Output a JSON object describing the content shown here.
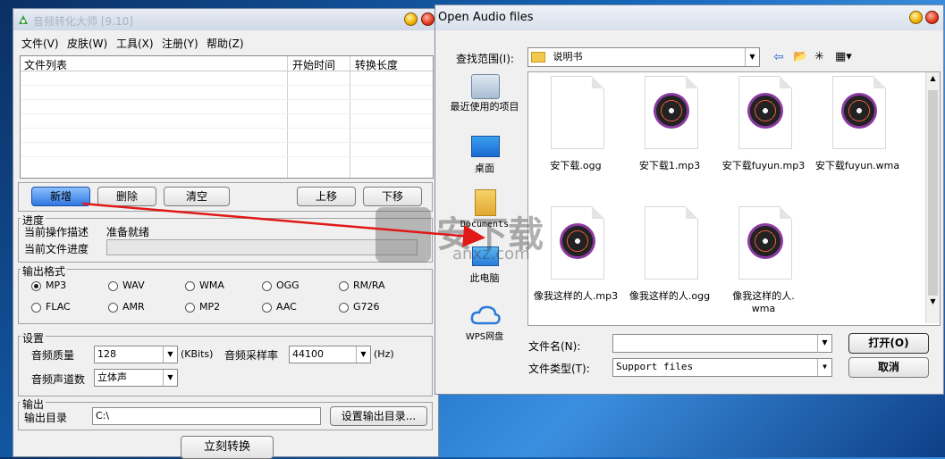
{
  "main_window": {
    "title": "音频转化大师 [9.10]",
    "menu": [
      "文件(V)",
      "皮肤(W)",
      "工具(X)",
      "注册(Y)",
      "帮助(Z)"
    ],
    "list_columns": [
      "文件列表",
      "开始时间",
      "转换长度"
    ],
    "buttons": {
      "add": "新增",
      "delete": "删除",
      "clear": "清空",
      "move_up": "上移",
      "move_down": "下移"
    },
    "progress": {
      "group_label": "进度",
      "current_op_label": "当前操作描述",
      "current_op_value": "准备就绪",
      "current_file_label": "当前文件进度",
      "file_progress": 0
    },
    "output_format": {
      "group_label": "输出格式",
      "options": [
        "MP3",
        "WAV",
        "WMA",
        "OGG",
        "RM/RA",
        "FLAC",
        "AMR",
        "MP2",
        "AAC",
        "G726"
      ],
      "selected": "MP3"
    },
    "settings": {
      "group_label": "设置",
      "quality_label": "音频质量",
      "quality_value": "128",
      "quality_unit": "(KBits)",
      "sample_rate_label": "音频采样率",
      "sample_rate_value": "44100",
      "sample_rate_unit": "(Hz)",
      "channels_label": "音频声道数",
      "channels_value": "立体声"
    },
    "output": {
      "group_label": "输出",
      "dir_label": "输出目录",
      "dir_value": "C:\\",
      "set_dir_button": "设置输出目录..."
    },
    "convert_button": "立刻转换"
  },
  "dialog": {
    "title": "Open Audio files",
    "look_in_label": "查找范围(I):",
    "look_in_value": "说明书",
    "places": [
      {
        "label": "最近使用的项目",
        "icon": "recent-icon"
      },
      {
        "label": "桌面",
        "icon": "desktop-icon"
      },
      {
        "label": "Documents",
        "icon": "documents-icon"
      },
      {
        "label": "此电脑",
        "icon": "computer-icon"
      },
      {
        "label": "WPS网盘",
        "icon": "cloud-icon"
      }
    ],
    "files": [
      {
        "name": "安下载.ogg",
        "icon": "blank-file-icon"
      },
      {
        "name": "安下载1.mp3",
        "icon": "music-disc-icon"
      },
      {
        "name": "安下载fuyun.mp3",
        "icon": "music-disc-icon"
      },
      {
        "name": "安下载fuyun.wma",
        "icon": "music-disc-icon"
      },
      {
        "name": "像我这样的人.mp3",
        "icon": "music-disc-icon"
      },
      {
        "name": "像我这样的人.ogg",
        "icon": "blank-file-icon"
      },
      {
        "name": "像我这样的人.",
        "name2": "wma",
        "icon": "music-disc-icon"
      }
    ],
    "filename_label": "文件名(N):",
    "filename_value": "",
    "filetype_label": "文件类型(T):",
    "filetype_value": "Support files",
    "open_button": "打开(O)",
    "cancel_button": "取消"
  },
  "watermark": {
    "text": "安下载",
    "subtext": "anxz.com"
  },
  "colors": {
    "arrow": "#e01818",
    "accent_button": "#2f77e0"
  }
}
